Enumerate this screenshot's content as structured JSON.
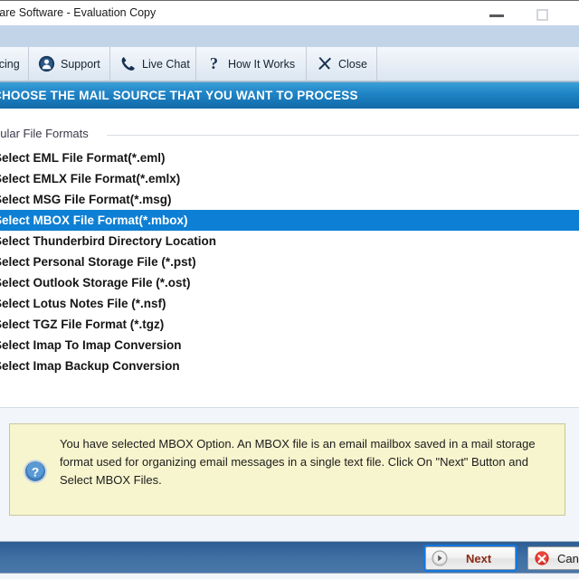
{
  "window": {
    "title": "vare Software - Evaluation Copy",
    "minimize_icon": "minimize-icon",
    "maximize_icon": "maximize-icon"
  },
  "toolbar": {
    "items": [
      {
        "label": "icing",
        "icon": "pricing-tag-icon"
      },
      {
        "label": "Support",
        "icon": "support-person-icon"
      },
      {
        "label": "Live Chat",
        "icon": "phone-icon"
      },
      {
        "label": "How It Works",
        "icon": "question-mark-icon"
      },
      {
        "label": "Close",
        "icon": "close-x-icon"
      }
    ]
  },
  "banner": {
    "text": "CHOOSE THE MAIL SOURCE THAT YOU WANT TO PROCESS",
    "color": "#1f84c6"
  },
  "list": {
    "group_header": "pular File Formats",
    "selected_index": 3,
    "selection_color": "#0d7fd4",
    "items": [
      {
        "label": "Select EML File Format(*.eml)"
      },
      {
        "label": "Select EMLX File Format(*.emlx)"
      },
      {
        "label": "Select MSG File Format(*.msg)"
      },
      {
        "label": "Select MBOX File Format(*.mbox)"
      },
      {
        "label": "Select Thunderbird Directory Location"
      },
      {
        "label": "Select Personal Storage File (*.pst)"
      },
      {
        "label": "Select Outlook Storage File (*.ost)"
      },
      {
        "label": "Select Lotus Notes File (*.nsf)"
      },
      {
        "label": "Select TGZ File Format (*.tgz)"
      },
      {
        "label": "Select Imap To Imap Conversion"
      },
      {
        "label": "Select Imap Backup Conversion"
      }
    ]
  },
  "info": {
    "icon": "help-question-icon",
    "message": "You have selected MBOX Option. An MBOX file is an email mailbox saved in a mail storage format used for organizing email messages in a single text file. Click On \"Next\" Button and Select MBOX Files.",
    "background_color": "#f7f5ce"
  },
  "footer": {
    "next_label": "Next",
    "next_icon": "next-arrow-icon",
    "cancel_label": "Cancel",
    "cancel_icon": "cancel-x-icon",
    "bar_color": "#3f6fa3"
  }
}
